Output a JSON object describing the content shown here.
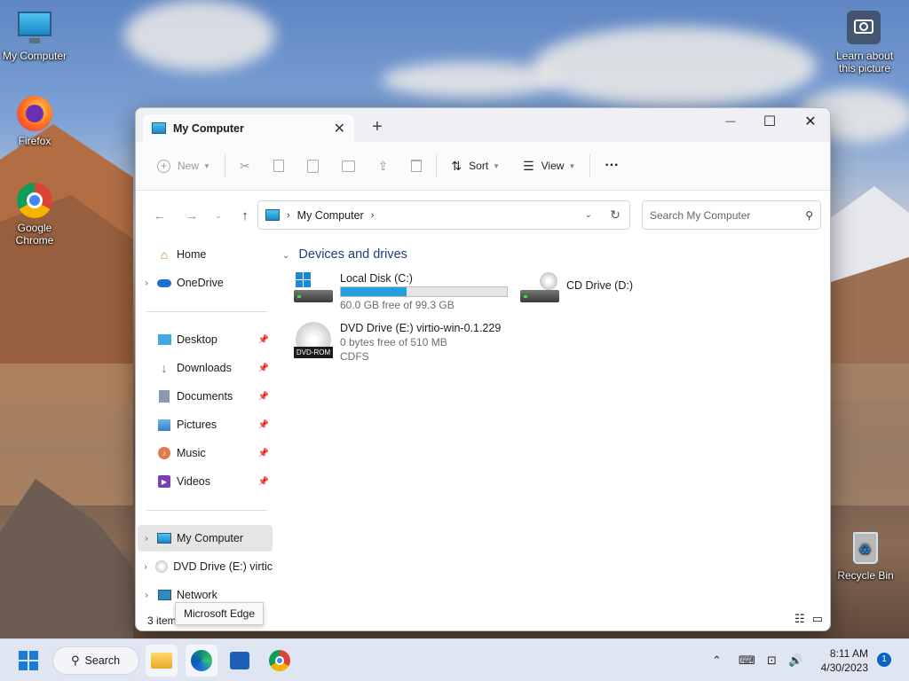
{
  "desktop": {
    "icons": [
      {
        "label": "My Computer"
      },
      {
        "label": "Firefox"
      },
      {
        "label": "Google Chrome"
      },
      {
        "label": "Recycle Bin"
      }
    ],
    "learn_label": "Learn about this picture"
  },
  "window": {
    "tab_title": "My Computer",
    "tab_close": "✕",
    "new_tab": "+",
    "controls": {
      "minimize": "—",
      "maximize": "☐",
      "close": "✕"
    },
    "toolbar": {
      "new_label": "New",
      "sort_label": "Sort",
      "view_label": "View",
      "more_label": "···"
    },
    "address": {
      "label": "My Computer"
    },
    "search": {
      "placeholder": "Search My Computer"
    },
    "sidebar": {
      "items": [
        {
          "label": "Home"
        },
        {
          "label": "OneDrive"
        },
        {
          "label": "Desktop"
        },
        {
          "label": "Downloads"
        },
        {
          "label": "Documents"
        },
        {
          "label": "Pictures"
        },
        {
          "label": "Music"
        },
        {
          "label": "Videos"
        },
        {
          "label": "My Computer"
        },
        {
          "label": "DVD Drive (E:) virtic"
        },
        {
          "label": "Network"
        }
      ]
    },
    "content": {
      "group_title": "Devices and drives",
      "drives": [
        {
          "name": "Local Disk (C:)",
          "free": "60.0 GB free of 99.3 GB",
          "used_fraction": 0.396
        },
        {
          "name": "CD Drive (D:)"
        },
        {
          "name": "DVD Drive (E:) virtio-win-0.1.229",
          "free": "0 bytes free of 510 MB",
          "fs": "CDFS",
          "icon_text": "DVD-ROM"
        }
      ]
    },
    "status": "3 item",
    "tooltip": "Microsoft Edge"
  },
  "taskbar": {
    "search_label": "Search",
    "time": "8:11 AM",
    "date": "4/30/2023",
    "notification_count": "1"
  },
  "colors": {
    "accent": "#26a0da",
    "group_title": "#1d3f7a"
  }
}
